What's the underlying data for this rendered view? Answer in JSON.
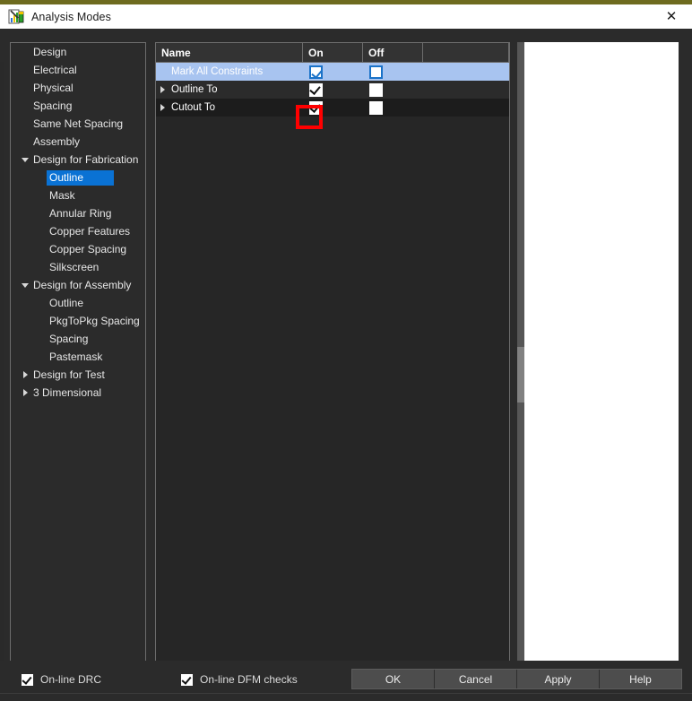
{
  "window": {
    "title": "Analysis Modes",
    "icon": "analysis-chart-icon",
    "close_label": "✕",
    "accent_top_color": "#6e6b1f"
  },
  "tree": {
    "items": [
      {
        "label": "Design",
        "indent": 1,
        "twisty": "none",
        "selected": false
      },
      {
        "label": "Electrical",
        "indent": 1,
        "twisty": "none",
        "selected": false
      },
      {
        "label": "Physical",
        "indent": 1,
        "twisty": "none",
        "selected": false
      },
      {
        "label": "Spacing",
        "indent": 1,
        "twisty": "none",
        "selected": false
      },
      {
        "label": "Same Net Spacing",
        "indent": 1,
        "twisty": "none",
        "selected": false
      },
      {
        "label": "Assembly",
        "indent": 1,
        "twisty": "none",
        "selected": false
      },
      {
        "label": "Design for Fabrication",
        "indent": 1,
        "twisty": "expanded",
        "selected": false
      },
      {
        "label": "Outline",
        "indent": 2,
        "twisty": "none",
        "selected": true
      },
      {
        "label": "Mask",
        "indent": 2,
        "twisty": "none",
        "selected": false
      },
      {
        "label": "Annular Ring",
        "indent": 2,
        "twisty": "none",
        "selected": false
      },
      {
        "label": "Copper Features",
        "indent": 2,
        "twisty": "none",
        "selected": false
      },
      {
        "label": "Copper Spacing",
        "indent": 2,
        "twisty": "none",
        "selected": false
      },
      {
        "label": "Silkscreen",
        "indent": 2,
        "twisty": "none",
        "selected": false
      },
      {
        "label": "Design for Assembly",
        "indent": 1,
        "twisty": "expanded",
        "selected": false
      },
      {
        "label": "Outline",
        "indent": 2,
        "twisty": "none",
        "selected": false
      },
      {
        "label": "PkgToPkg Spacing",
        "indent": 2,
        "twisty": "none",
        "selected": false
      },
      {
        "label": "Spacing",
        "indent": 2,
        "twisty": "none",
        "selected": false
      },
      {
        "label": "Pastemask",
        "indent": 2,
        "twisty": "none",
        "selected": false
      },
      {
        "label": "Design for Test",
        "indent": 1,
        "twisty": "collapsed",
        "selected": false
      },
      {
        "label": "3 Dimensional",
        "indent": 1,
        "twisty": "collapsed",
        "selected": false
      }
    ],
    "selection_color": "#0a72d4"
  },
  "table": {
    "columns": [
      {
        "key": "name",
        "label": "Name"
      },
      {
        "key": "on",
        "label": "On"
      },
      {
        "key": "off",
        "label": "Off"
      }
    ],
    "rows": [
      {
        "name": "Mark All Constraints",
        "twisty": "none",
        "on": "checked",
        "off": "unchecked",
        "selected": true,
        "checkbox_style": "blue",
        "annotated": true
      },
      {
        "name": "Outline To",
        "twisty": "collapsed",
        "on": "checked",
        "off": "unchecked",
        "selected": false,
        "checkbox_style": "black",
        "annotated": false
      },
      {
        "name": "Cutout To",
        "twisty": "collapsed",
        "on": "checked",
        "off": "unchecked",
        "selected": false,
        "checkbox_style": "black",
        "annotated": false
      }
    ],
    "selected_row_color": "#a8c4f0"
  },
  "annotation": {
    "type": "rectangle-highlight",
    "color": "#ff0000",
    "target": "mark-all-constraints-on-checkbox"
  },
  "footer": {
    "checkboxes": [
      {
        "label": "On-line DRC",
        "checked": true
      },
      {
        "label": "On-line DFM checks",
        "checked": true
      }
    ],
    "buttons": [
      {
        "label": "OK"
      },
      {
        "label": "Cancel"
      },
      {
        "label": "Apply"
      },
      {
        "label": "Help"
      }
    ]
  }
}
